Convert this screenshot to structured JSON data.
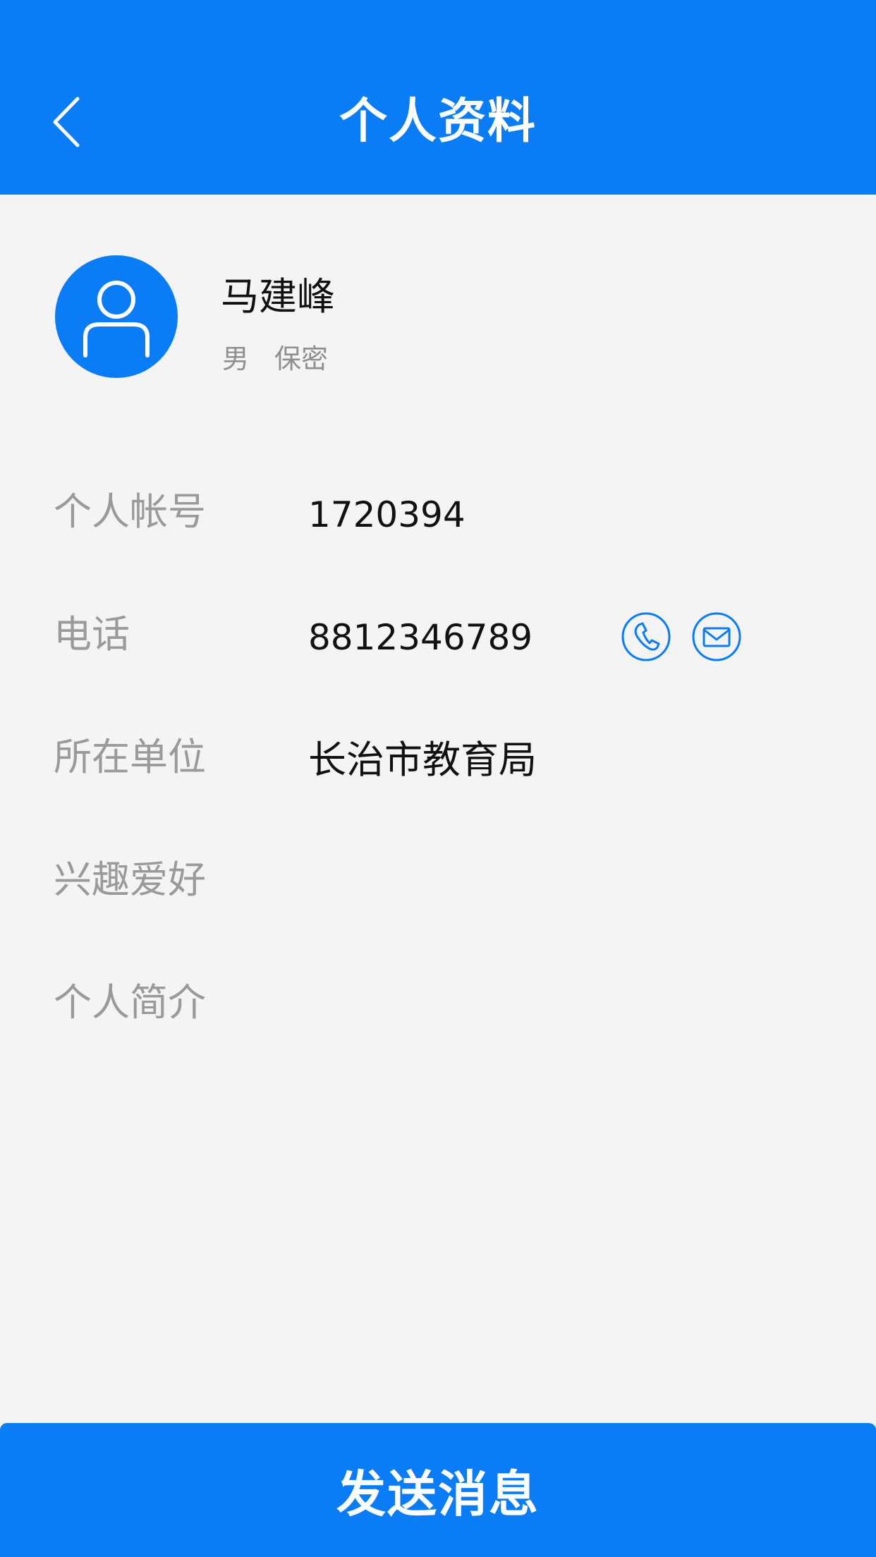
{
  "header": {
    "title": "个人资料",
    "back_icon": "chevron-left-icon"
  },
  "profile": {
    "name": "马建峰",
    "gender": "男",
    "privacy": "保密",
    "avatar_icon": "user-avatar-icon"
  },
  "fields": [
    {
      "label": "个人帐号",
      "value": "1720394"
    },
    {
      "label": "电话",
      "value": "8812346789"
    },
    {
      "label": "所在单位",
      "value": "长治市教育局"
    },
    {
      "label": "兴趣爱好",
      "value": ""
    },
    {
      "label": "个人简介",
      "value": ""
    }
  ],
  "actions": {
    "call_icon": "phone-icon",
    "sms_icon": "mail-icon",
    "send_label": "发送消息"
  },
  "colors": {
    "primary": "#0a7cf5",
    "background": "#f4f4f5",
    "label": "#9a9a9a",
    "text": "#111111"
  }
}
